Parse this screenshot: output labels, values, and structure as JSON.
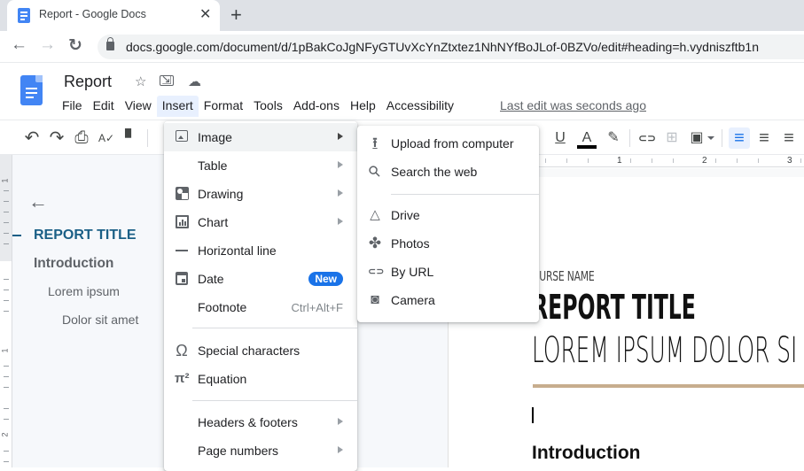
{
  "browser": {
    "tab_title": "Report - Google Docs",
    "close_glyph": "✕",
    "newtab_glyph": "+",
    "url": "docs.google.com/document/d/1pBakCoJgNFyGTUvXcYnZtxtez1NhNYfBoJLof-0BZVo/edit#heading=h.vydniszftb1n",
    "back_glyph": "←",
    "forward_glyph": "→",
    "reload_glyph": "↻"
  },
  "header": {
    "doc_title": "Report",
    "star_glyph": "☆",
    "move_glyph": "⇲",
    "cloud_glyph": "☁",
    "menus": [
      "File",
      "Edit",
      "View",
      "Insert",
      "Format",
      "Tools",
      "Add-ons",
      "Help",
      "Accessibility"
    ],
    "active_menu": "Insert",
    "last_edit": "Last edit was seconds ago"
  },
  "toolbar": {
    "undo": "↶",
    "redo": "↷",
    "print": "⎙",
    "spellcheck": "A✓",
    "paint_format": "▘",
    "underline": "U",
    "text_color": "A",
    "highlight": "✎",
    "link": "⊂⊃",
    "comment": "⊞",
    "image": "▣",
    "align_left": "≡",
    "align_center": "≡",
    "align_right": "≡",
    "text_color_value": "#000000",
    "active_align": "left"
  },
  "outline": {
    "back_glyph": "←",
    "items": [
      {
        "label": "REPORT TITLE",
        "level": 0,
        "active": true
      },
      {
        "label": "Introduction",
        "level": 1
      },
      {
        "label": "Lorem ipsum",
        "level": 2
      },
      {
        "label": "Dolor sit amet",
        "level": 3
      }
    ]
  },
  "ruler": {
    "horizontal_numbers": [
      "1",
      "2",
      "3"
    ],
    "vertical_numbers": [
      "1",
      "1",
      "2"
    ]
  },
  "document": {
    "course_name": "OURSE NAME",
    "report_title": "REPORT TITLE",
    "subtitle": "LOREM IPSUM DOLOR SI",
    "intro_heading": "Introduction",
    "accent_rule_color": "#c7ad8e"
  },
  "insert_menu": {
    "items": [
      {
        "label": "Image",
        "icon": "image-icon",
        "submenu": true,
        "hover": true
      },
      {
        "label": "Table",
        "icon": "",
        "submenu": true
      },
      {
        "label": "Drawing",
        "icon": "drawing-icon",
        "submenu": true
      },
      {
        "label": "Chart",
        "icon": "chart-icon",
        "submenu": true
      },
      {
        "label": "Horizontal line",
        "icon": "horizontal-line-icon"
      },
      {
        "label": "Date",
        "icon": "date-icon",
        "badge": "New"
      },
      {
        "label": "Footnote",
        "shortcut": "Ctrl+Alt+F"
      },
      {
        "label": "Special characters",
        "icon": "omega-icon",
        "glyph": "Ω"
      },
      {
        "label": "Equation",
        "icon": "pi-icon",
        "glyph": "π²"
      },
      {
        "label": "Headers & footers",
        "submenu": true
      },
      {
        "label": "Page numbers",
        "submenu": true
      }
    ]
  },
  "image_submenu": {
    "items": [
      {
        "label": "Upload from computer",
        "icon": "upload-icon",
        "glyph": "⭱"
      },
      {
        "label": "Search the web",
        "icon": "search-icon",
        "glyph": "⚲"
      },
      {
        "label": "Drive",
        "icon": "drive-icon",
        "glyph": "△"
      },
      {
        "label": "Photos",
        "icon": "photos-icon",
        "glyph": "✤"
      },
      {
        "label": "By URL",
        "icon": "link-icon",
        "glyph": "⊂⊃"
      },
      {
        "label": "Camera",
        "icon": "camera-icon",
        "glyph": "◙"
      }
    ]
  },
  "colors": {
    "accent": "#1a73e8",
    "outline_active": "#1a5f86",
    "menu_hover": "#f1f3f4"
  }
}
